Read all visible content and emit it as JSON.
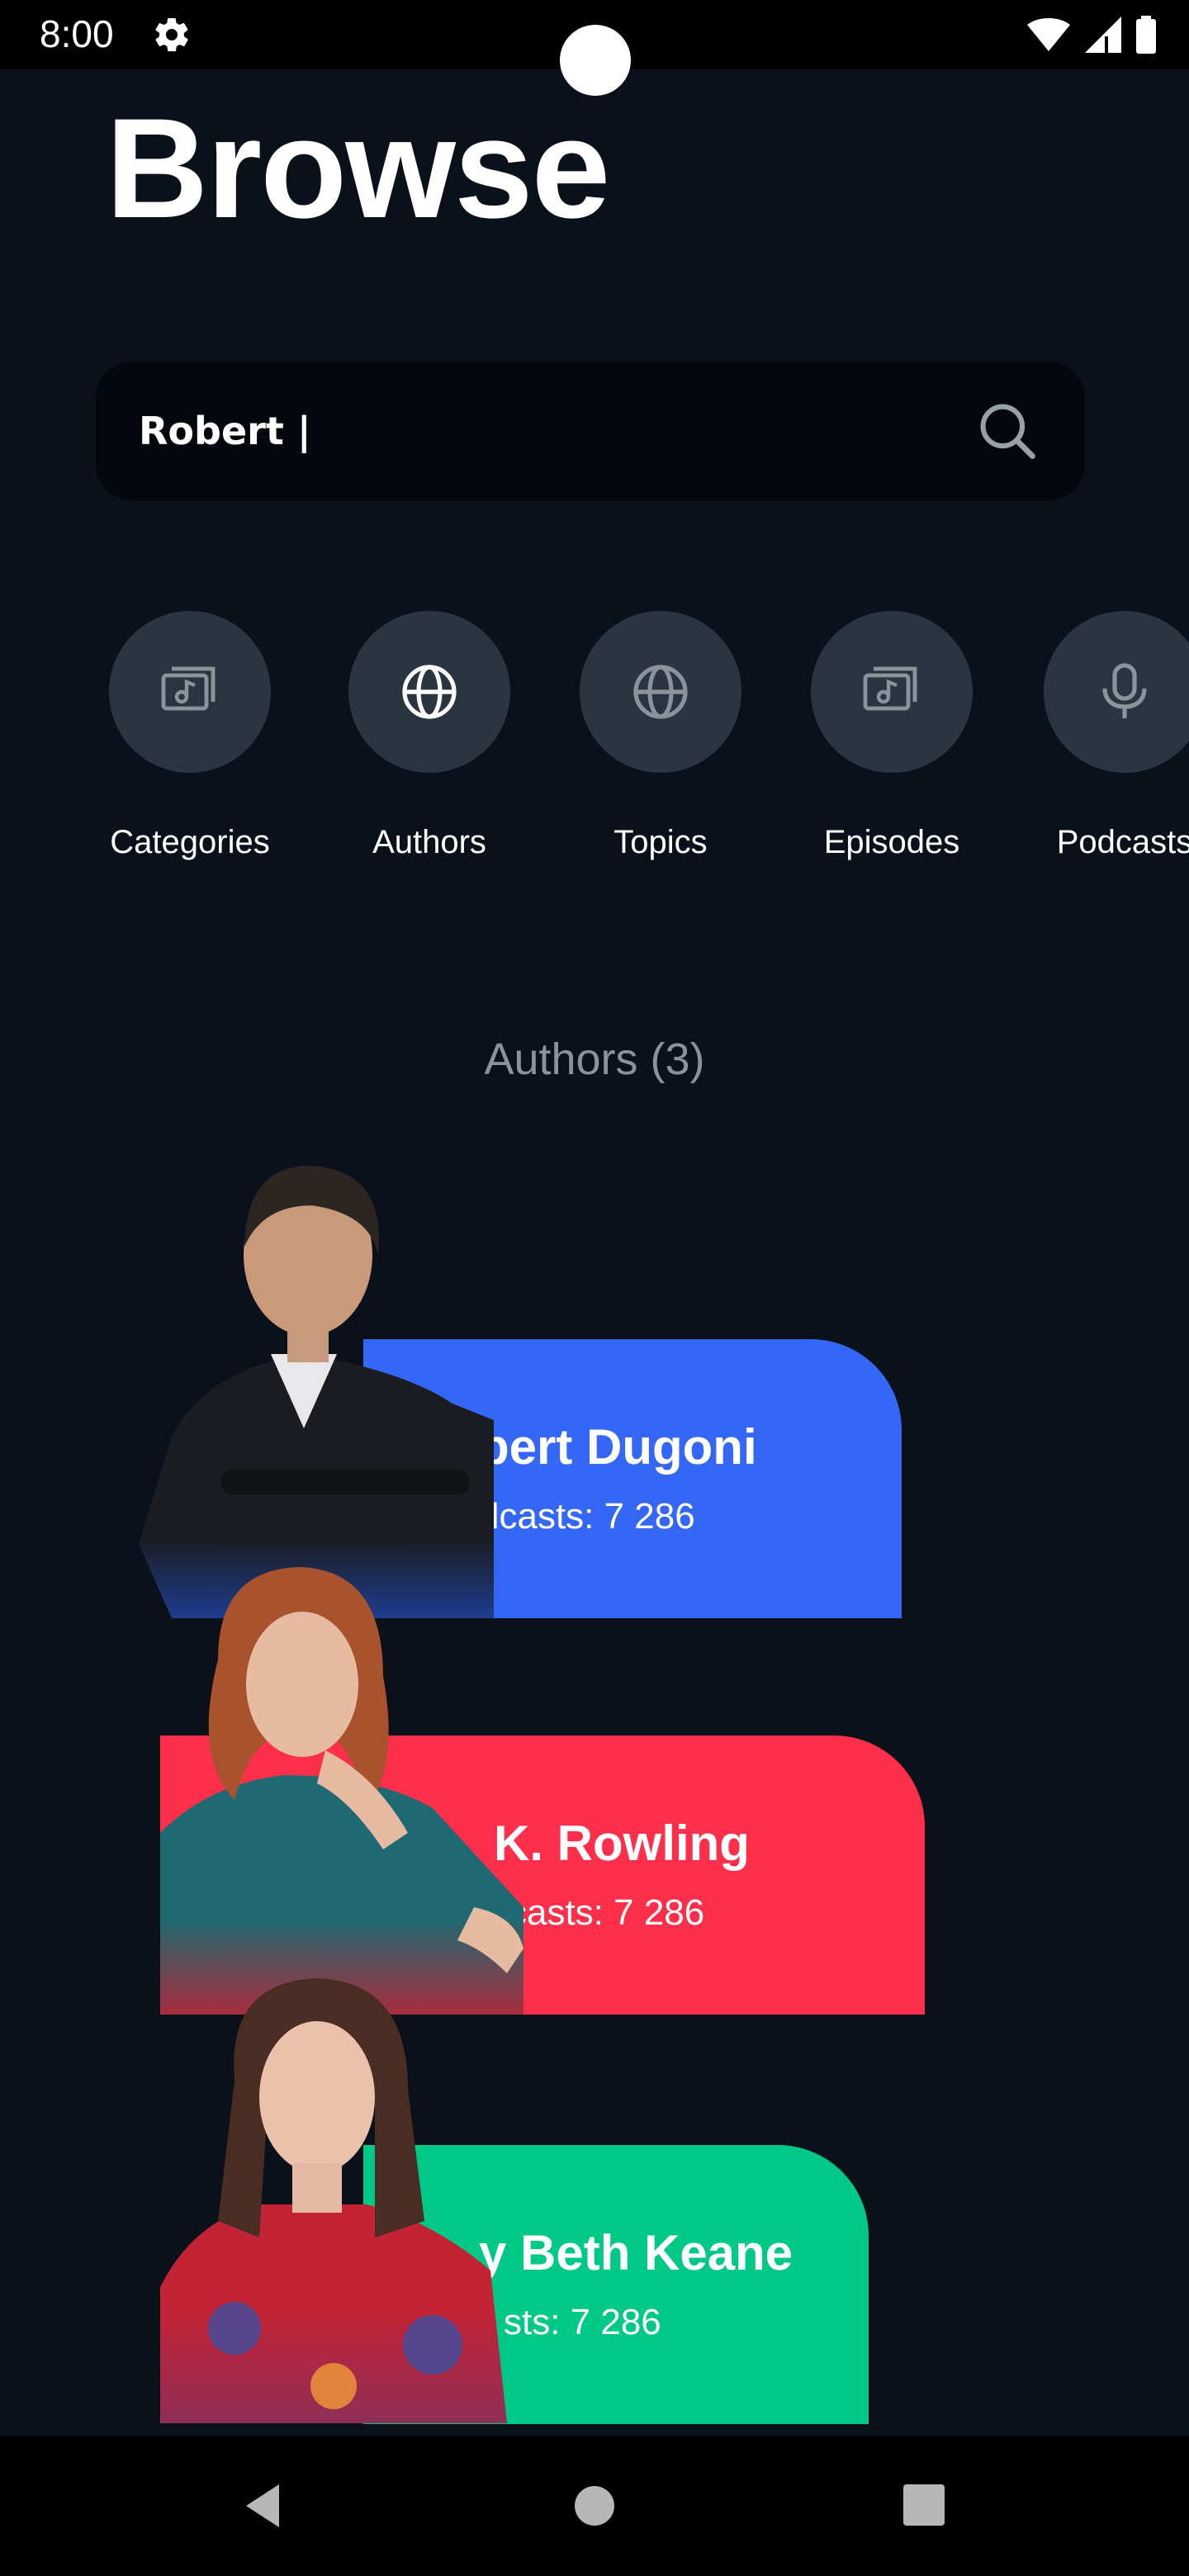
{
  "status": {
    "time": "8:00"
  },
  "header": {
    "title": "Browse"
  },
  "search": {
    "value": "Robert |"
  },
  "categories": [
    {
      "label": "Categories",
      "icon": "music-video-icon"
    },
    {
      "label": "Authors",
      "icon": "globe-icon"
    },
    {
      "label": "Topics",
      "icon": "globe-icon"
    },
    {
      "label": "Episodes",
      "icon": "music-video-icon"
    },
    {
      "label": "Podcasts",
      "icon": "microphone-icon"
    }
  ],
  "section": {
    "title": "Authors (3)"
  },
  "authors": [
    {
      "name_visible": "bert Dugoni",
      "sub_visible": "dcasts: 7 286",
      "color": "#3467f5"
    },
    {
      "name_visible": "K. Rowling",
      "sub_visible": "casts: 7 286",
      "color": "#fd2f4b"
    },
    {
      "name_visible": "y Beth Keane",
      "sub_visible": "sts: 7 286",
      "color": "#00c886"
    }
  ],
  "colors": {
    "background": "#0a111b",
    "search_bg": "#04080e",
    "category_circle": "#2b3541"
  }
}
